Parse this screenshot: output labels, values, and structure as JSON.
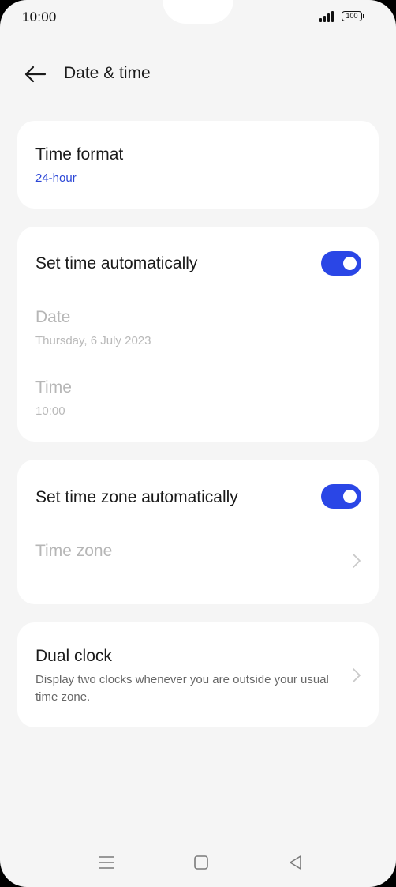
{
  "status_bar": {
    "time": "10:00",
    "battery": "100"
  },
  "header": {
    "title": "Date & time"
  },
  "time_format": {
    "title": "Time format",
    "value": "24-hour"
  },
  "auto_time": {
    "title": "Set time automatically",
    "enabled": true,
    "date_label": "Date",
    "date_value": "Thursday, 6 July 2023",
    "time_label": "Time",
    "time_value": "10:00"
  },
  "auto_zone": {
    "title": "Set time zone automatically",
    "enabled": true,
    "zone_label": "Time zone"
  },
  "dual_clock": {
    "title": "Dual clock",
    "description": "Display two clocks whenever you are outside your usual time zone."
  },
  "icons": {
    "back": "back-arrow-icon",
    "chevron": "chevron-right-icon",
    "nav_menu": "menu-icon",
    "nav_home": "home-icon",
    "nav_back": "back-triangle-icon"
  },
  "colors": {
    "accent": "#2a46e6",
    "accent_text": "#2b46d6",
    "background": "#f5f5f5",
    "card": "#ffffff",
    "disabled_text": "#b6b6b6"
  }
}
